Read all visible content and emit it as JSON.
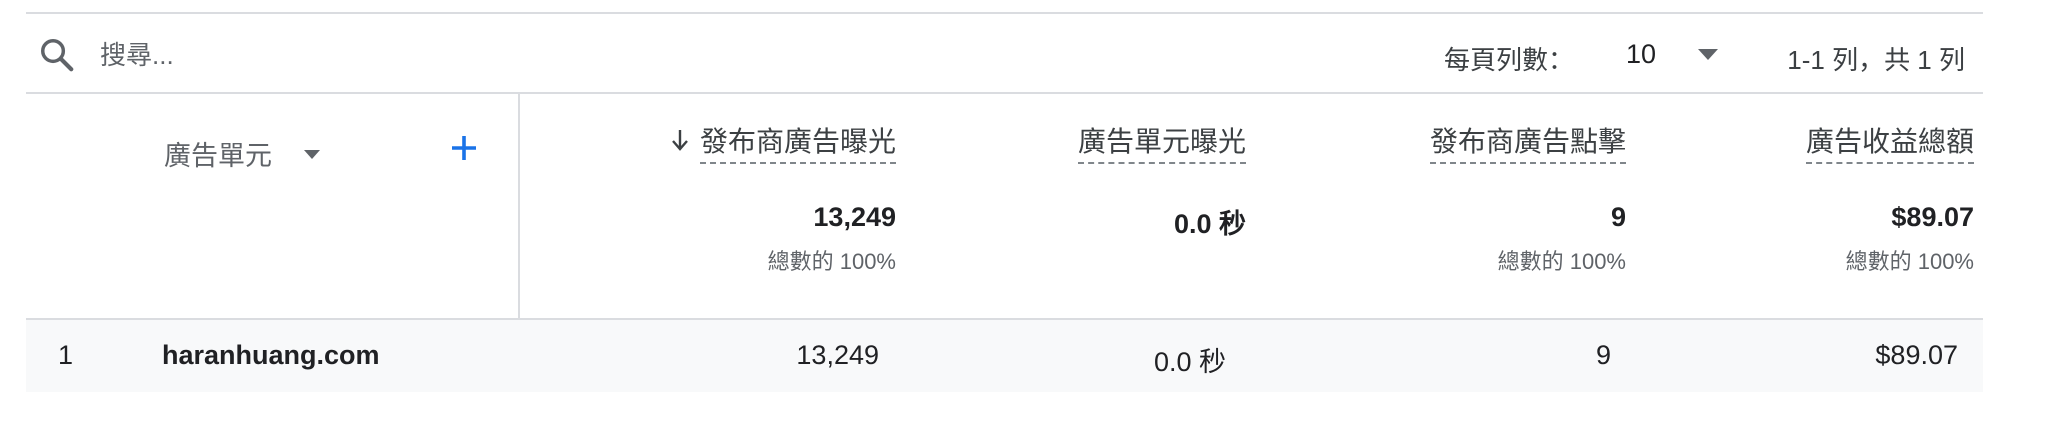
{
  "search": {
    "placeholder": "搜尋..."
  },
  "pagination": {
    "rows_per_page_label": "每頁列數：",
    "rows_per_page_value": "10",
    "range_text": "1-1 列，共 1 列"
  },
  "dimension": {
    "label": "廣告單元"
  },
  "columns": [
    {
      "header": "發布商廣告曝光",
      "total": "13,249",
      "percent": "總數的 100%"
    },
    {
      "header": "廣告單元曝光",
      "total": "0.0 秒",
      "percent": ""
    },
    {
      "header": "發布商廣告點擊",
      "total": "9",
      "percent": "總數的 100%"
    },
    {
      "header": "廣告收益總額",
      "total": "$89.07",
      "percent": "總數的 100%"
    }
  ],
  "rows": [
    {
      "index": "1",
      "name": "haranhuang.com",
      "values": [
        "13,249",
        "0.0 秒",
        "9",
        "$89.07"
      ]
    }
  ],
  "colors": {
    "accent": "#1a73e8",
    "divider": "#dadce0",
    "row_bg": "#f8f9fa"
  },
  "icons": {
    "search": "search-icon",
    "sort": "arrow-down-icon",
    "add": "plus-icon",
    "dropdown": "caret-down-icon"
  }
}
